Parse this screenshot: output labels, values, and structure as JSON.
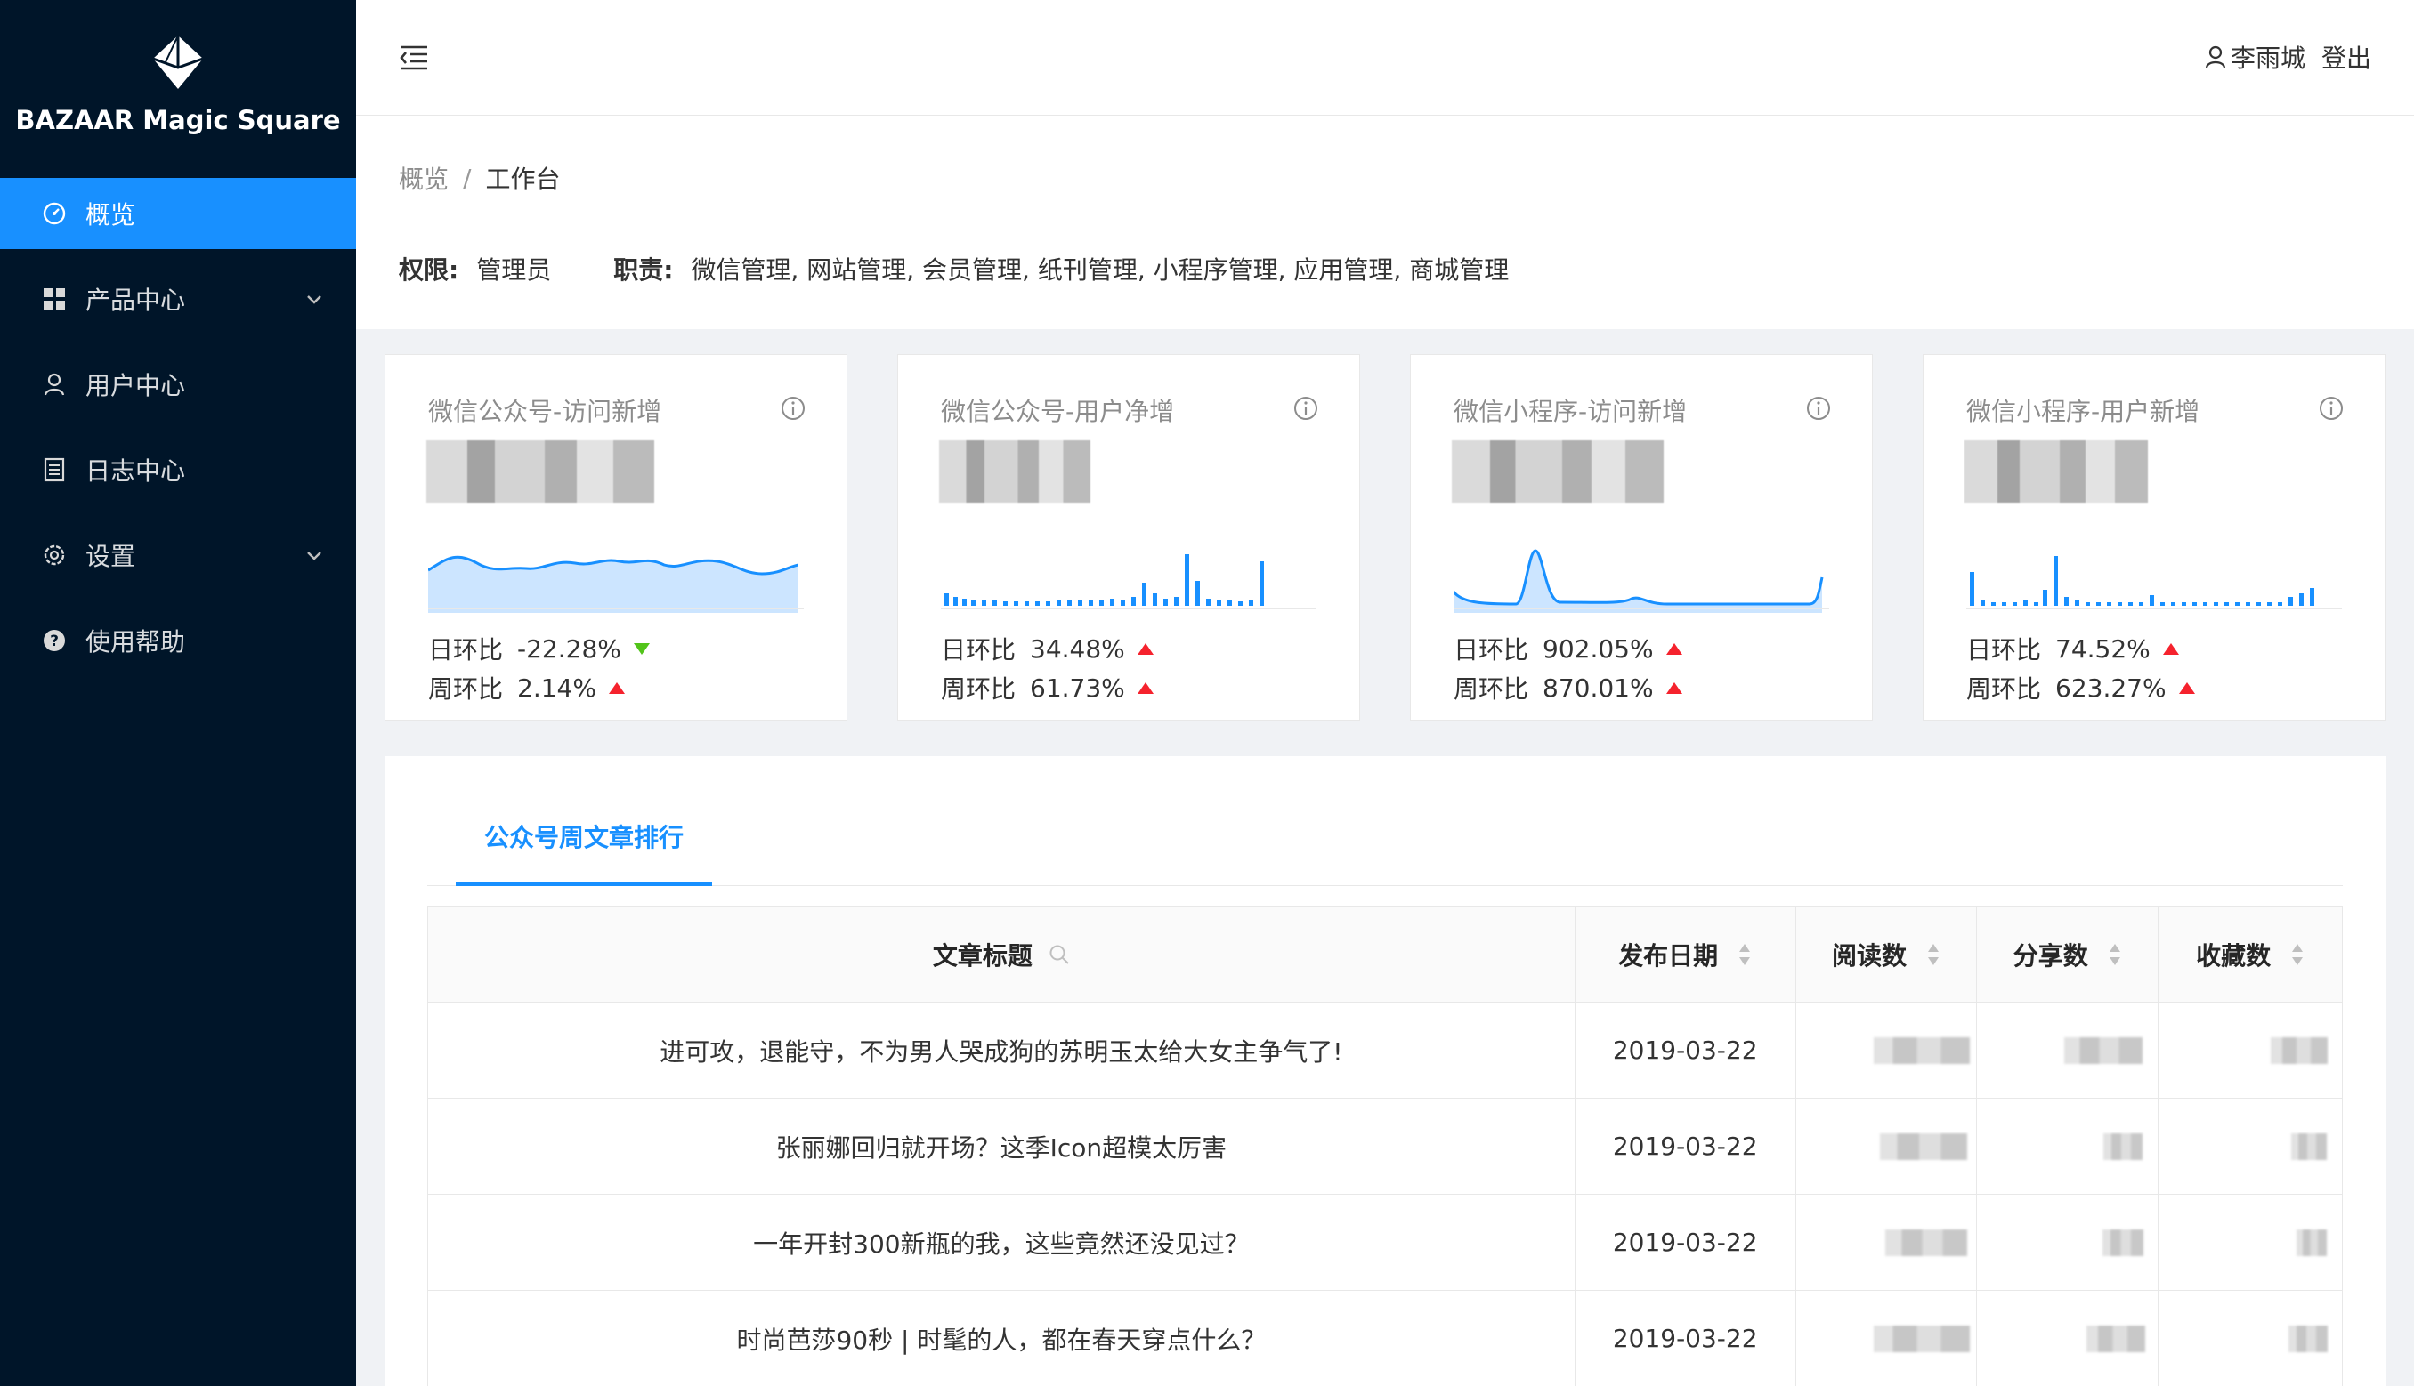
{
  "sidebar": {
    "brand": "BAZAAR Magic Square",
    "items": [
      {
        "label": "概览",
        "icon": "dashboard-icon",
        "active": true
      },
      {
        "label": "产品中心",
        "icon": "appstore-icon",
        "caret": true
      },
      {
        "label": "用户中心",
        "icon": "user-icon"
      },
      {
        "label": "日志中心",
        "icon": "file-icon"
      },
      {
        "label": "设置",
        "icon": "setting-icon",
        "caret": true
      },
      {
        "label": "使用帮助",
        "icon": "question-circle-icon"
      }
    ]
  },
  "header": {
    "user_name": "李雨城",
    "logout_label": "登出"
  },
  "breadcrumb": [
    "概览",
    "/",
    "工作台"
  ],
  "permissions": {
    "role_label": "权限:",
    "role_value": "管理员",
    "duty_label": "职责:",
    "duty_value": "微信管理, 网站管理, 会员管理, 纸刊管理, 小程序管理, 应用管理, 商城管理"
  },
  "cards": [
    {
      "title": "微信公众号-访问新增",
      "daily_label": "日环比",
      "daily": "-22.28%",
      "daily_trend": "down",
      "weekly_label": "周环比",
      "weekly": "2.14%",
      "weekly_trend": "up",
      "chart": "area"
    },
    {
      "title": "微信公众号-用户净增",
      "daily_label": "日环比",
      "daily": "34.48%",
      "daily_trend": "up",
      "weekly_label": "周环比",
      "weekly": "61.73%",
      "weekly_trend": "up",
      "chart": "bar"
    },
    {
      "title": "微信小程序-访问新增",
      "daily_label": "日环比",
      "daily": "902.05%",
      "daily_trend": "up",
      "weekly_label": "周环比",
      "weekly": "870.01%",
      "weekly_trend": "up",
      "chart": "area"
    },
    {
      "title": "微信小程序-用户新增",
      "daily_label": "日环比",
      "daily": "74.52%",
      "daily_trend": "up",
      "weekly_label": "周环比",
      "weekly": "623.27%",
      "weekly_trend": "up",
      "chart": "bar"
    }
  ],
  "tabs": [
    {
      "label": "公众号周文章排行",
      "active": true
    }
  ],
  "table": {
    "columns": [
      "文章标题",
      "发布日期",
      "阅读数",
      "分享数",
      "收藏数"
    ],
    "rows": [
      {
        "title": "进可攻，退能守，不为男人哭成狗的苏明玉太给大女主争气了!",
        "date": "2019-03-22"
      },
      {
        "title": "张丽娜回归就开场？这季Icon超模太厉害",
        "date": "2019-03-22"
      },
      {
        "title": "一年开封300新瓶的我，这些竟然还没见过？",
        "date": "2019-03-22"
      },
      {
        "title": "时尚芭莎90秒 | 时髦的人，都在春天穿点什么？",
        "date": "2019-03-22"
      }
    ]
  },
  "colors": {
    "primary": "#1890ff",
    "sidebar": "#001529",
    "up": "#f5222d",
    "down": "#52c41a"
  }
}
